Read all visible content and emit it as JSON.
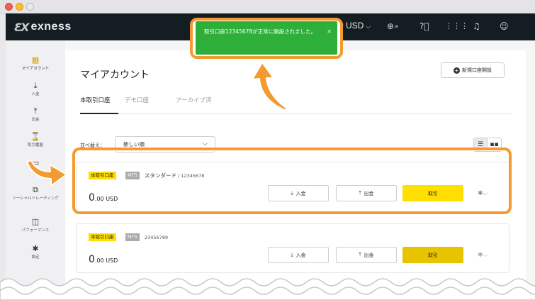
{
  "topbar": {
    "logo_text": "exness",
    "balance": "0 USD",
    "lang_code": "JA"
  },
  "notification": {
    "message": "取引口座12345678が正常に開設されました。"
  },
  "sidebar": {
    "items": [
      {
        "label": "マイアカウント"
      },
      {
        "label": "入金"
      },
      {
        "label": "出金"
      },
      {
        "label": "取引履歴"
      },
      {
        "label": ""
      },
      {
        "label": "ソーシャルトレーディング"
      },
      {
        "label": "パフォーマンス"
      },
      {
        "label": "設定"
      }
    ]
  },
  "main": {
    "title": "マイアカウント",
    "new_account_label": "新規口座開設",
    "tabs": [
      "本取引口座",
      "デモ口座",
      "アーカイブ済"
    ],
    "sort_label": "並べ替え：",
    "sort_value": "新しい順"
  },
  "accounts": [
    {
      "badge": "本取引口座",
      "platform": "MT5",
      "type": "スタンダード",
      "number": " / 12345678",
      "amount_major": "0",
      "amount_minor": ".00 USD",
      "deposit_label": "入金",
      "withdraw_label": "出金",
      "trade_label": "取引"
    },
    {
      "badge": "本取引口座",
      "platform": "MT5",
      "type": "",
      "number": "23456789",
      "amount_major": "0",
      "amount_minor": ".00 USD",
      "deposit_label": "入金",
      "withdraw_label": "出金",
      "trade_label": "取引"
    }
  ],
  "colors": {
    "brand_yellow": "#ffde02",
    "toast_green": "#2eaf3a",
    "highlight_orange": "#f39b30",
    "nav_dark": "#141d22"
  }
}
